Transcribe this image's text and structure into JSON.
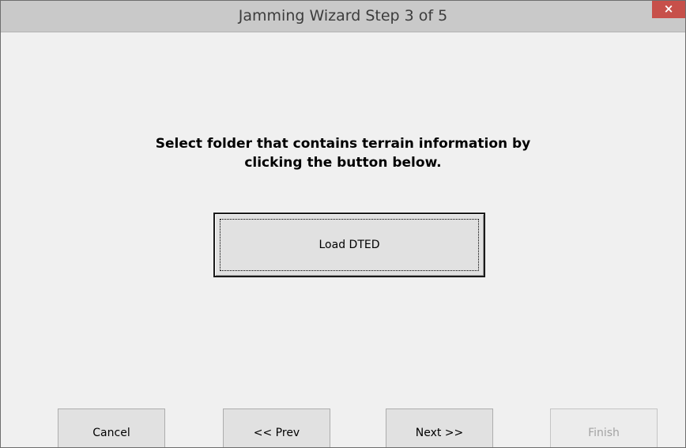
{
  "window": {
    "title": "Jamming Wizard Step 3 of 5",
    "close_glyph": "×"
  },
  "content": {
    "instruction_line1": "Select folder that contains terrain information by",
    "instruction_line2": "clicking the button below.",
    "load_button_label": "Load DTED"
  },
  "footer": {
    "cancel_label": "Cancel",
    "prev_label": "<< Prev",
    "next_label": "Next >>",
    "finish_label": "Finish"
  },
  "colors": {
    "titlebar": "#c9c9c9",
    "close_button": "#c7504a",
    "dialog_background": "#f0f0f0",
    "button_face": "#e1e1e1",
    "disabled_text": "#a3a3a3"
  },
  "icons": {
    "close": "close-icon"
  }
}
